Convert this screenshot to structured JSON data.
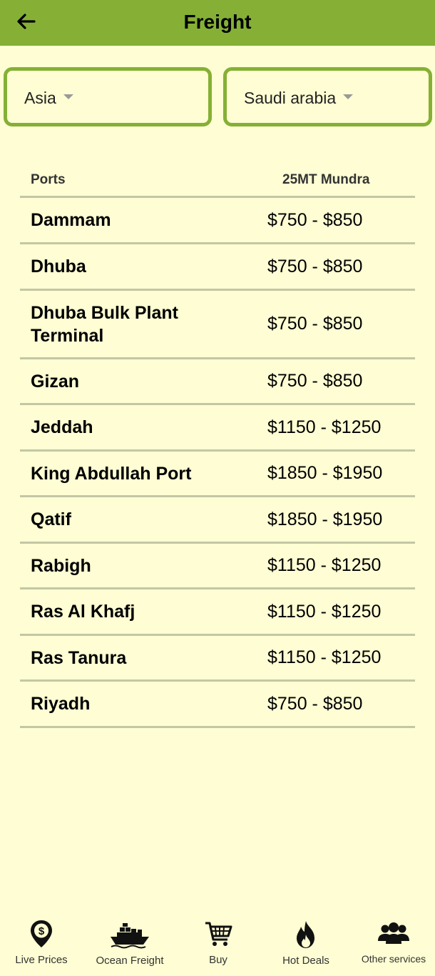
{
  "appbar": {
    "title": "Freight",
    "back_icon": "arrow-left-icon"
  },
  "filters": {
    "region": {
      "value": "Asia"
    },
    "country": {
      "value": "Saudi arabia"
    }
  },
  "table": {
    "headers": {
      "ports": "Ports",
      "rate": "25MT Mundra"
    },
    "rows": [
      {
        "port": "Dammam",
        "price": "$750 - $850"
      },
      {
        "port": "Dhuba",
        "price": "$750 - $850"
      },
      {
        "port": "Dhuba Bulk Plant Terminal",
        "price": "$750 - $850"
      },
      {
        "port": "Gizan",
        "price": "$750 - $850"
      },
      {
        "port": "Jeddah",
        "price": "$1150 - $1250"
      },
      {
        "port": "King Abdullah Port",
        "price": "$1850 - $1950"
      },
      {
        "port": "Qatif",
        "price": "$1850 - $1950"
      },
      {
        "port": "Rabigh",
        "price": "$1150 - $1250"
      },
      {
        "port": "Ras Al Khafj",
        "price": "$1150 - $1250"
      },
      {
        "port": "Ras Tanura",
        "price": "$1150 - $1250"
      },
      {
        "port": "Riyadh",
        "price": "$750 - $850"
      }
    ]
  },
  "nav": {
    "items": [
      {
        "label": "Live Prices",
        "icon": "location-dollar-icon"
      },
      {
        "label": "Ocean Freight",
        "icon": "cargo-ship-icon"
      },
      {
        "label": "Buy",
        "icon": "shopping-cart-icon"
      },
      {
        "label": "Hot Deals",
        "icon": "flame-icon"
      },
      {
        "label": "Other services",
        "icon": "users-icon"
      }
    ]
  },
  "colors": {
    "appbar": "#85b035",
    "background": "#fefdd3",
    "divider": "#c4c7a4"
  }
}
